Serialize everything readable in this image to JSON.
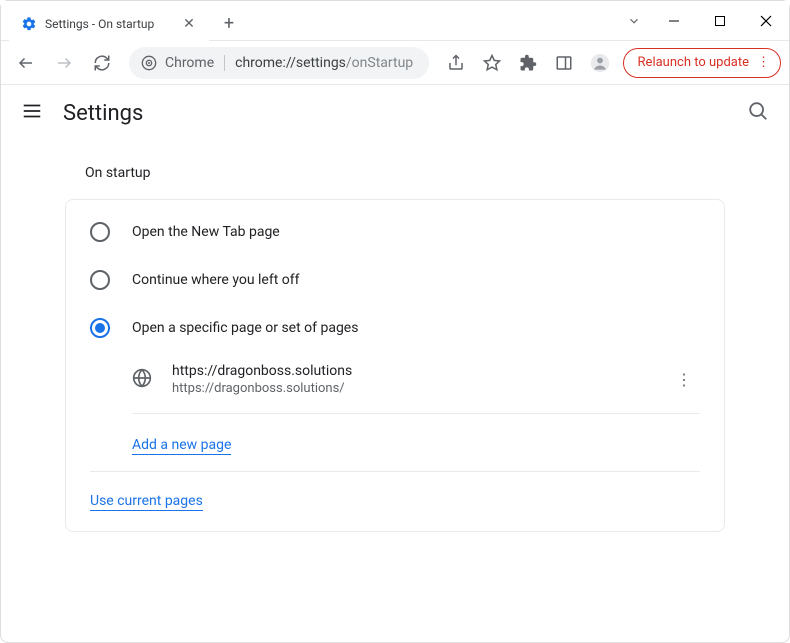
{
  "window": {
    "tab_title": "Settings - On startup"
  },
  "toolbar": {
    "omnibox_label": "Chrome",
    "omnibox_url_host": "chrome://settings",
    "omnibox_url_path": "/onStartup",
    "relaunch_label": "Relaunch to update"
  },
  "header": {
    "title": "Settings"
  },
  "section": {
    "title": "On startup",
    "options": [
      {
        "label": "Open the New Tab page",
        "selected": false
      },
      {
        "label": "Continue where you left off",
        "selected": false
      },
      {
        "label": "Open a specific page or set of pages",
        "selected": true
      }
    ],
    "startup_page": {
      "title": "https://dragonboss.solutions",
      "url": "https://dragonboss.solutions/"
    },
    "add_page_label": "Add a new page",
    "use_current_label": "Use current pages"
  }
}
